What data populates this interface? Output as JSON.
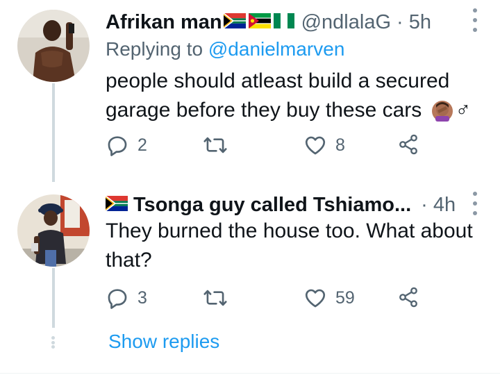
{
  "tweets": [
    {
      "display_name": "Afrikan man",
      "handle": "@ndlalaG",
      "separator": "·",
      "time": "5h",
      "replying_prefix": "Replying to ",
      "replying_to": "@danielmarven",
      "text": "people should atleast build a secured garage before they buy these cars",
      "emoji_tail": "♂",
      "reply_count": "2",
      "retweet_count": "",
      "like_count": "8"
    },
    {
      "display_name": "Tsonga guy called Tshiamo...",
      "separator": "·",
      "time": "4h",
      "text": "They burned the house too. What about that?",
      "reply_count": "3",
      "retweet_count": "",
      "like_count": "59"
    }
  ],
  "show_replies": "Show replies",
  "colors": {
    "accent": "#1d9bf0",
    "muted": "#536471",
    "text": "#0f1419",
    "thread_line": "#cfd9de"
  },
  "icons": [
    "more-vertical-icon",
    "reply-icon",
    "retweet-icon",
    "like-icon",
    "share-icon",
    "south-africa-flag-icon",
    "mozambique-flag-icon",
    "nigeria-flag-icon",
    "facepalm-emoji-icon"
  ]
}
